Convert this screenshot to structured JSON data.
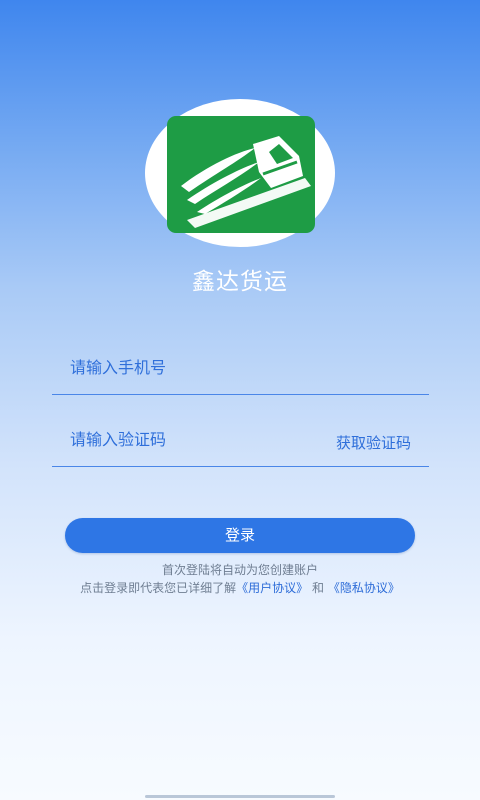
{
  "app": {
    "name": "鑫达货运"
  },
  "login_form": {
    "phone_placeholder": "请输入手机号",
    "code_placeholder": "请输入验证码",
    "get_code_label": "获取验证码",
    "login_label": "登录"
  },
  "notice": {
    "line1": "首次登陆将自动为您创建账户",
    "line2_prefix": "点击登录即代表您已详细了解",
    "user_agreement": "《用户协议》",
    "conjunction": "和",
    "privacy_agreement": "《隐私协议》"
  },
  "colors": {
    "brand_green": "#1e9c45",
    "primary_blue": "#2e76e5",
    "link_blue": "#2d6cd8"
  },
  "icons": {
    "logo": "winged-truck-logo"
  }
}
